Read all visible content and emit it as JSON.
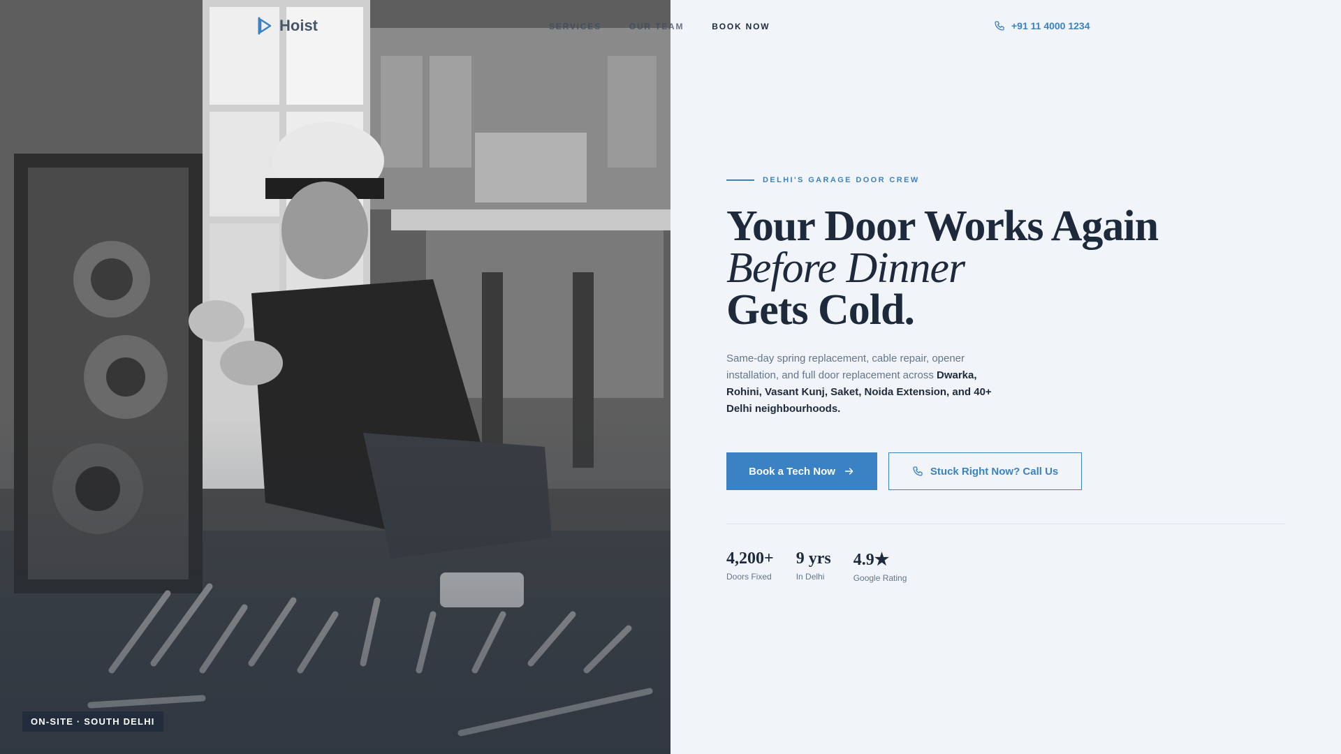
{
  "brand": {
    "name": "Hoist",
    "logo_icon": "play-flag-icon",
    "accent": "#3b82c4"
  },
  "nav": {
    "links": [
      "Services",
      "Our Team",
      "Book Now"
    ],
    "phone": "+91 11 4000 1234",
    "phone_icon": "phone-icon"
  },
  "photo": {
    "alt": "Technician repairing garage door opener",
    "badge": "ON-SITE · SOUTH DELHI"
  },
  "hero": {
    "eyebrow": "DELHI'S GARAGE DOOR CREW",
    "headline_line1": "Your Door Works Again",
    "headline_line2": "Before Dinner",
    "headline_line3": "Gets Cold.",
    "lede_intro": "Same-day spring replacement, cable repair, opener installation, and full door replacement across ",
    "lede_bold": "Dwarka, Rohini, Vasant Kunj, Saket, Noida Extension, and 40+ Delhi neighbourhoods.",
    "primary_cta": "Book a Tech Now",
    "primary_cta_icon": "arrow-right-icon",
    "secondary_cta": "Stuck Right Now? Call Us",
    "secondary_cta_icon": "phone-icon"
  },
  "stats": [
    {
      "value": "4,200+",
      "label": "Doors Fixed"
    },
    {
      "value": "9 yrs",
      "label": "In Delhi"
    },
    {
      "value": "4.9★",
      "label": "Google Rating"
    }
  ]
}
